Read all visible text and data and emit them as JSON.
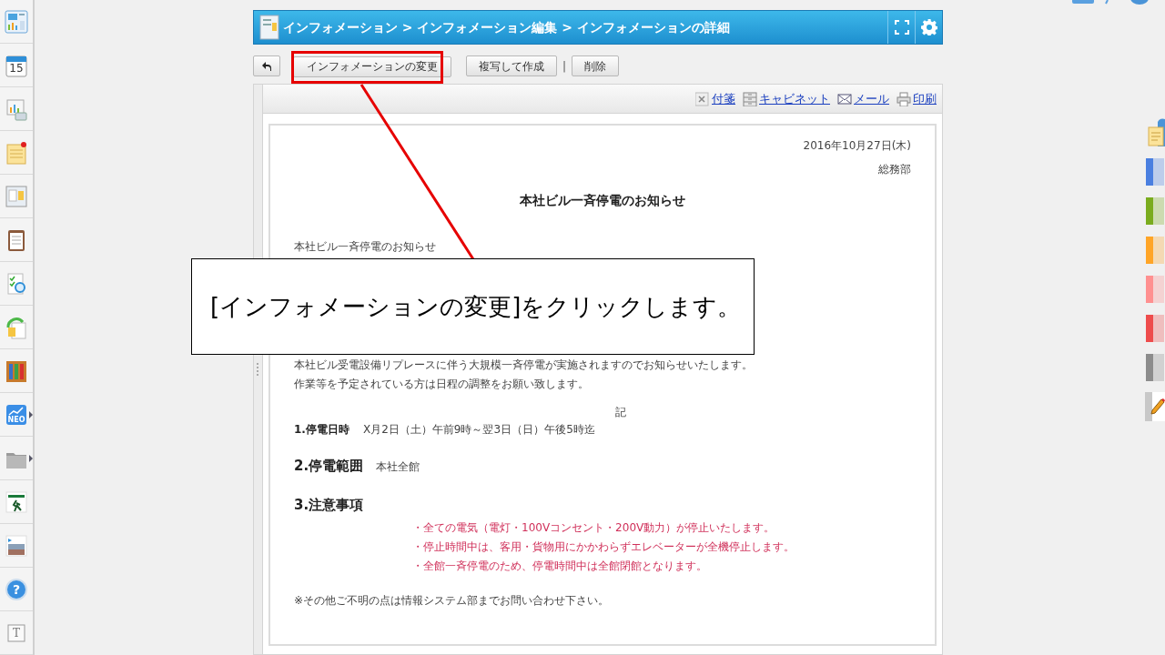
{
  "sidebar": {
    "items": [
      {
        "kind": "dashboard"
      },
      {
        "kind": "calendar",
        "label": "15"
      },
      {
        "kind": "chart"
      },
      {
        "kind": "memo"
      },
      {
        "kind": "board"
      },
      {
        "kind": "clipboard"
      },
      {
        "kind": "search-doc"
      },
      {
        "kind": "refresh-doc"
      },
      {
        "kind": "binders"
      },
      {
        "kind": "neo",
        "label": "NEO",
        "submenu": true
      },
      {
        "kind": "folder",
        "submenu": true
      },
      {
        "kind": "runner"
      },
      {
        "kind": "photo"
      },
      {
        "kind": "help",
        "label": "?"
      },
      {
        "kind": "text",
        "label": "T"
      }
    ]
  },
  "header": {
    "breadcrumb": "インフォメーション > インフォメーション編集 > インフォメーションの詳細"
  },
  "toolbar": [
    {
      "kind": "back"
    },
    {
      "kind": "button",
      "label": "インフォメーションの変更",
      "highlighted": true
    },
    {
      "kind": "button",
      "label": "複写して作成",
      "highlighted": false
    },
    {
      "kind": "separator",
      "label": "|"
    },
    {
      "kind": "button",
      "label": "削除",
      "highlighted": false
    }
  ],
  "actions": [
    {
      "kind": "sticky",
      "label": "付箋"
    },
    {
      "kind": "cabinet",
      "label": "キャビネット"
    },
    {
      "kind": "mail",
      "label": "メール"
    },
    {
      "kind": "print",
      "label": "印刷"
    }
  ],
  "document": {
    "date": "2016年10月27日(木)",
    "department": "総務部",
    "title": "本社ビル一斉停電のお知らせ",
    "intro": "本社ビル一斉停電のお知らせ",
    "body": [
      "本社ビル受電設備リプレースに伴う大規模一斉停電が実施されますのでお知らせいたします。",
      "作業等を予定されている方は日程の調整をお願い致します。"
    ],
    "ki": "記",
    "items": [
      {
        "kind": "small",
        "label": "1.停電日時",
        "value": "X月2日（土）午前9時～翌3日（日）午後5時迄"
      },
      {
        "kind": "large",
        "label": "2.停電範囲",
        "value": "本社全館"
      },
      {
        "kind": "large",
        "label": "3.注意事項"
      }
    ],
    "notes": [
      "・全ての電気（電灯・100Vコンセント・200V動力）が停止いたします。",
      "・停止時間中は、客用・貨物用にかかわらずエレベーターが全機停止します。",
      "・全館一斉停電のため、停電時間中は全館閉館となります。"
    ],
    "footer": "※その他ご不明の点は情報システム部までお問い合わせ下さい。"
  },
  "callout": {
    "text": "[インフォメーションの変更]をクリックします。"
  },
  "right_tabs": [
    {
      "kind": "note"
    },
    {
      "kind": "color",
      "color": "#4a7fe0"
    },
    {
      "kind": "color",
      "color": "#7aac1e"
    },
    {
      "kind": "color",
      "color": "#ffa527"
    },
    {
      "kind": "color",
      "color": "#ff9090"
    },
    {
      "kind": "color",
      "color": "#ee4c4c"
    },
    {
      "kind": "color",
      "color": "#8c8c8c"
    },
    {
      "kind": "pencil"
    }
  ]
}
